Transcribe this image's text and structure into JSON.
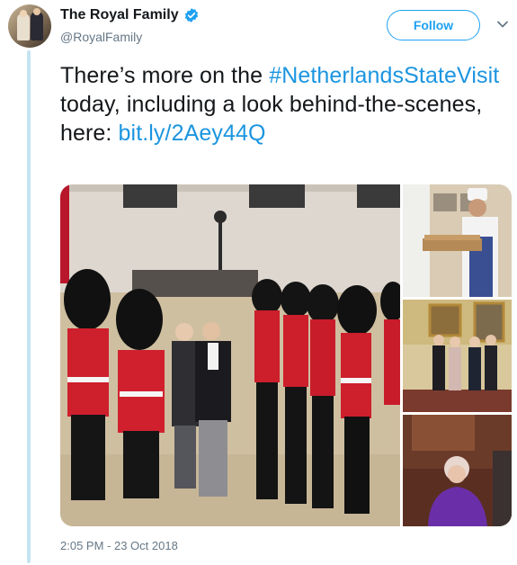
{
  "account": {
    "display_name": "The Royal Family",
    "handle": "@RoyalFamily",
    "verified_icon": "verified-badge-icon",
    "avatar_icon": "profile-avatar"
  },
  "actions": {
    "follow_label": "Follow",
    "menu_icon": "chevron-down-icon"
  },
  "tweet": {
    "text_before": "There’s more on the ",
    "hashtag": "#NetherlandsStateVisit",
    "text_after": " today, including a look behind-the-scenes, here: ",
    "link": "bit.ly/2Aey44Q",
    "timestamp": "2:05 PM - 23 Oct 2018"
  },
  "media": {
    "photos": [
      "guard-inspection-photo",
      "chef-baking-photo",
      "palace-group-photo",
      "queen-photo"
    ]
  },
  "colors": {
    "brand_blue": "#1da1f2",
    "link_blue": "#1b95e0",
    "muted": "#657786",
    "thread_line": "#c4e4f2"
  }
}
